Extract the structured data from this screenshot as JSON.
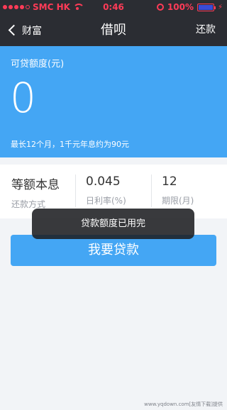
{
  "status_bar": {
    "carrier": "SMC HK",
    "time": "0:46",
    "battery": "100%",
    "battery_level": 1.0
  },
  "nav": {
    "back_label": "财富",
    "title": "借呗",
    "action_label": "还款"
  },
  "hero": {
    "label": "可贷额度(元)",
    "amount": "0",
    "note": "最长12个月，1千元年息约为90元"
  },
  "info": [
    {
      "value": "等额本息",
      "label": "还款方式"
    },
    {
      "value": "0.045",
      "label": "日利率(%)"
    },
    {
      "value": "12",
      "label": "期限(月)"
    }
  ],
  "toast": {
    "message": "贷款额度已用完"
  },
  "apply_button": {
    "label": "我要贷款"
  },
  "watermark": "www.yqdown.com[友情下载]提供",
  "colors": {
    "accent": "#44a6f4",
    "header": "#2b2d33",
    "status_red": "#ff3b57"
  }
}
